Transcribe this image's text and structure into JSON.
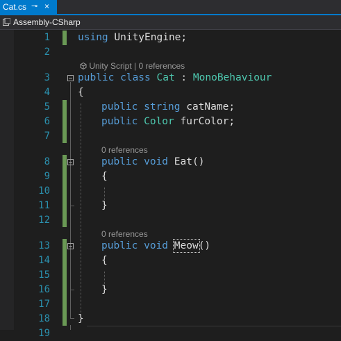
{
  "tab": {
    "label": "Cat.cs",
    "pin": "⊸",
    "close": "×"
  },
  "navbar": {
    "project": "Assembly-CSharp"
  },
  "line_numbers": [
    "1",
    "2",
    "3",
    "4",
    "5",
    "6",
    "7",
    "8",
    "9",
    "10",
    "11",
    "12",
    "13",
    "14",
    "15",
    "16",
    "17",
    "18",
    "19"
  ],
  "code": {
    "l1_kw": "using",
    "l1_rest": " UnityEngine;",
    "lens_class": "Unity Script | 0 references",
    "l3_kw": "public class ",
    "l3_name": "Cat",
    "l3_sep": " : ",
    "l3_base": "MonoBehaviour",
    "brace_open": "{",
    "brace_close": "}",
    "l5_kw": "public string ",
    "l5_rest": "catName;",
    "l6_kw": "public ",
    "l6_type": "Color",
    "l6_rest": " furColor;",
    "lens_eat": "0 references",
    "l8_kw": "public void ",
    "l8_name": "Eat",
    "l8_rest": "()",
    "lens_meow": "0 references",
    "l13_kw": "public void ",
    "l13_name": "Meow",
    "l13_rest": "()"
  }
}
